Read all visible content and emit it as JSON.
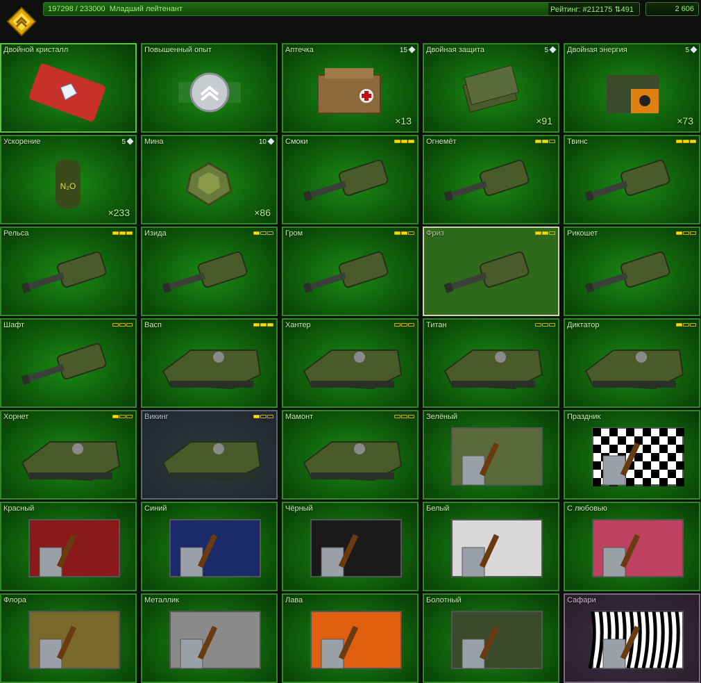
{
  "header": {
    "xp_text": "197298 / 233000",
    "rank_name": "Младший лейтенант",
    "rating_text": "Рейтинг: #212175",
    "rating_change": "491",
    "crystals": "2 606",
    "xp_progress": 0.847
  },
  "colors": {
    "accent": "#2f8a22",
    "label": "#c6f3a4",
    "star": "#ffd800"
  },
  "cards": [
    {
      "name": "Двойной кристалл",
      "art": "card"
    },
    {
      "name": "Повышенный опыт",
      "art": "xp"
    },
    {
      "name": "Аптечка",
      "price": "15",
      "count": "×13",
      "art": "medkit"
    },
    {
      "name": "Двойная защита",
      "price": "5",
      "count": "×91",
      "art": "armor"
    },
    {
      "name": "Двойная энергия",
      "price": "5",
      "count": "×73",
      "art": "energy"
    },
    {
      "name": "Ускорение",
      "price": "5",
      "count": "×233",
      "art": "nitro"
    },
    {
      "name": "Мина",
      "price": "10",
      "count": "×86",
      "art": "mine"
    },
    {
      "name": "Смоки",
      "stars": 3,
      "art": "turret"
    },
    {
      "name": "Огнемёт",
      "stars": 2,
      "art": "turret"
    },
    {
      "name": "Твинс",
      "stars": 3,
      "art": "turret"
    },
    {
      "name": "Рельса",
      "stars": 3,
      "art": "turret"
    },
    {
      "name": "Изида",
      "stars": 1,
      "art": "turret2"
    },
    {
      "name": "Гром",
      "stars": 2,
      "art": "turret"
    },
    {
      "name": "Фриз",
      "stars": 2,
      "art": "turret2"
    },
    {
      "name": "Рикошет",
      "stars": 1,
      "art": "turret"
    },
    {
      "name": "Шафт",
      "stars": 0,
      "art": "turret"
    },
    {
      "name": "Васп",
      "stars": 3,
      "art": "hull"
    },
    {
      "name": "Хантер",
      "stars": 0,
      "art": "hull"
    },
    {
      "name": "Титан",
      "stars": 0,
      "art": "hull"
    },
    {
      "name": "Диктатор",
      "stars": 1,
      "art": "hull"
    },
    {
      "name": "Хорнет",
      "stars": 1,
      "art": "hull"
    },
    {
      "name": "Викинг",
      "stars": 1,
      "art": "hull"
    },
    {
      "name": "Мамонт",
      "stars": 0,
      "art": "hull"
    },
    {
      "name": "Зелёный",
      "art": "paint",
      "paint_color": "#5a6a3a"
    },
    {
      "name": "Праздник",
      "art": "paint",
      "paint_color": "checker"
    },
    {
      "name": "Красный",
      "art": "paint",
      "paint_color": "#8a1a1a"
    },
    {
      "name": "Синий",
      "art": "paint",
      "paint_color": "#1a2a6a"
    },
    {
      "name": "Чёрный",
      "art": "paint",
      "paint_color": "#1a1a1a"
    },
    {
      "name": "Белый",
      "art": "paint",
      "paint_color": "#d8d8d8"
    },
    {
      "name": "С любовью",
      "art": "paint",
      "paint_color": "#c04060"
    },
    {
      "name": "Флора",
      "art": "paint",
      "paint_color": "#7a6a2a"
    },
    {
      "name": "Металлик",
      "art": "paint",
      "paint_color": "#8a8a8a"
    },
    {
      "name": "Лава",
      "art": "paint",
      "paint_color": "#e06010"
    },
    {
      "name": "Болотный",
      "art": "paint",
      "paint_color": "#3a4a2a"
    },
    {
      "name": "Сафари",
      "art": "paint",
      "paint_color": "zebra"
    }
  ]
}
